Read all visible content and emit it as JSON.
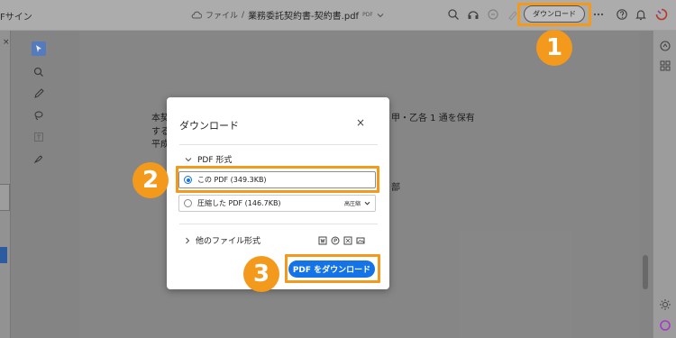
{
  "topbar": {
    "left_text": "Fサイン",
    "cloud_label": "ファイル",
    "separator": "/",
    "document_name": "業務委託契約書-契約書.pdf",
    "doc_tag": "PDF",
    "download_button": "ダウンロード"
  },
  "document": {
    "lines": [
      "本契",
      "する",
      "平成",
      "甲・乙各 1 通を保有",
      "部"
    ]
  },
  "dialog": {
    "title": "ダウンロード",
    "close": "×",
    "section_pdf": "PDF 形式",
    "option_this": "この PDF (349.3KB)",
    "option_compressed": "圧縮した PDF (146.7KB)",
    "compression_level": "高圧縮",
    "section_other": "他のファイル形式",
    "download_pdf_button": "PDF をダウンロード"
  },
  "callouts": [
    "1",
    "2",
    "3"
  ],
  "colors": {
    "accent": "#f39a1d",
    "primary": "#1473e6"
  }
}
